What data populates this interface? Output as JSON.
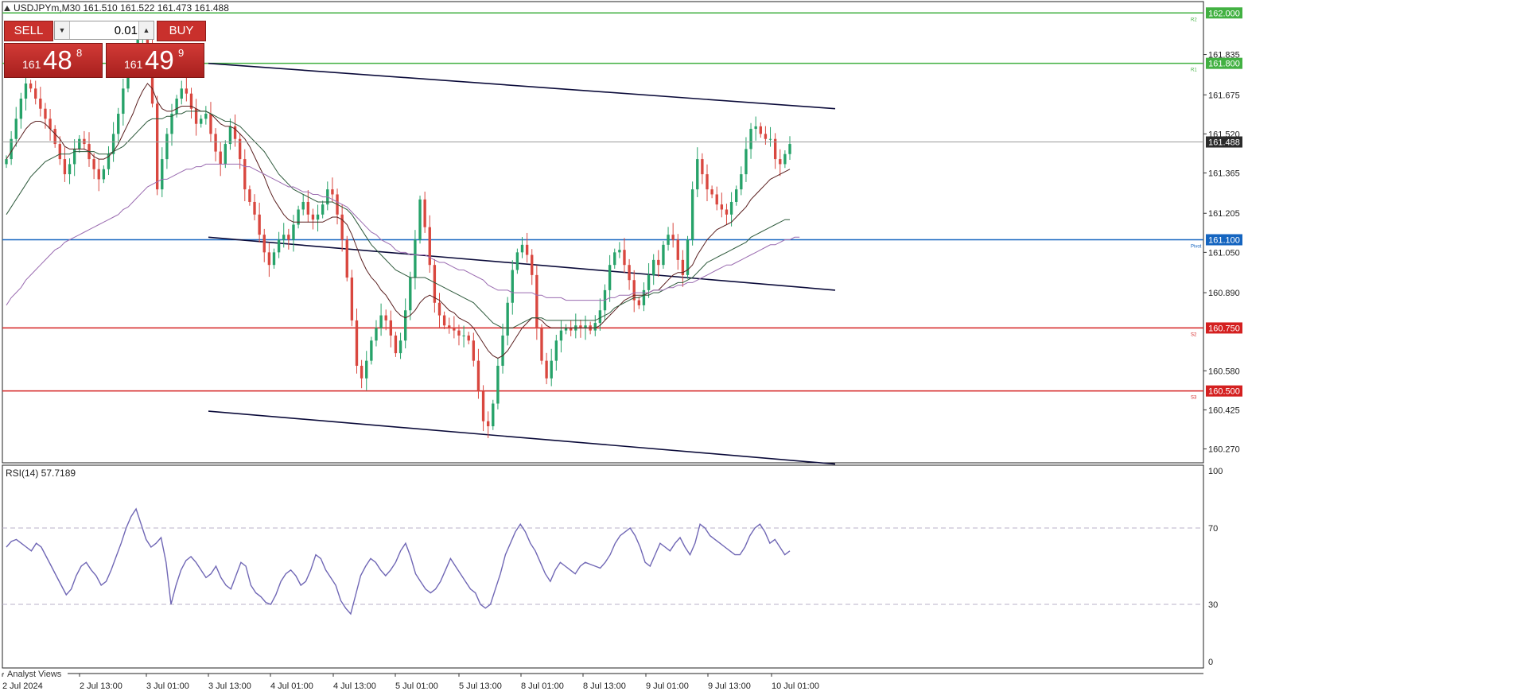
{
  "header": {
    "symbol_info": "USDJPYm,M30  161.510 161.522 161.473 161.488",
    "arrow_icon": "triangle-up-icon"
  },
  "trade_panel": {
    "sell_label": "SELL",
    "buy_label": "BUY",
    "lot_value": "0.01",
    "sell_price": {
      "prefix": "161",
      "big": "48",
      "sup": "8"
    },
    "buy_price": {
      "prefix": "161",
      "big": "49",
      "sup": "9"
    }
  },
  "indicator": {
    "label": "RSI(14) 57.7189"
  },
  "bottom_tab": "Analyst Views",
  "colors": {
    "bull": "#26a269",
    "bear": "#d9473f",
    "green_line": "#42b142",
    "blue_line": "#1565c0",
    "red_line": "#d42020",
    "rsi_line": "#7067b5",
    "ma_fast": "#5a1f1f",
    "ma_mid": "#2e5a3c",
    "ma_slow": "#9a6bb0"
  },
  "chart_data": {
    "type": "candlestick",
    "symbol": "USDJPYm",
    "timeframe": "M30",
    "ohlc_header": {
      "open": 161.51,
      "high": 161.522,
      "low": 161.473,
      "close": 161.488
    },
    "current_price": 161.488,
    "price_axis_ticks": [
      161.835,
      161.675,
      161.52,
      161.365,
      161.205,
      161.05,
      160.89,
      160.58,
      160.425,
      160.27
    ],
    "ylim": [
      160.215,
      162.045
    ],
    "x_tick_labels": [
      "2 Jul 2024",
      "2 Jul 13:00",
      "3 Jul 01:00",
      "3 Jul 13:00",
      "4 Jul 01:00",
      "4 Jul 13:00",
      "5 Jul 01:00",
      "5 Jul 13:00",
      "8 Jul 01:00",
      "8 Jul 13:00",
      "9 Jul 01:00",
      "9 Jul 13:00",
      "10 Jul 01:00"
    ],
    "horizontal_levels": [
      {
        "price": 162.0,
        "label": "162.000",
        "tag": "R2",
        "color": "#42b142"
      },
      {
        "price": 161.8,
        "label": "161.800",
        "tag": "R1",
        "color": "#42b142"
      },
      {
        "price": 161.1,
        "label": "161.100",
        "tag": "Pivot",
        "color": "#1565c0"
      },
      {
        "price": 160.75,
        "label": "160.750",
        "tag": "S2",
        "color": "#d42020"
      },
      {
        "price": 160.5,
        "label": "160.500",
        "tag": "S3",
        "color": "#d42020"
      }
    ],
    "trend_channel": [
      {
        "from": [
          "3 Jul 13:00",
          161.8
        ],
        "to": [
          "10 Jul 13:00",
          161.62
        ]
      },
      {
        "from": [
          "3 Jul 13:00",
          161.11
        ],
        "to": [
          "10 Jul 13:00",
          160.9
        ]
      },
      {
        "from": [
          "3 Jul 13:00",
          160.42
        ],
        "to": [
          "10 Jul 13:00",
          160.21
        ]
      }
    ],
    "close_series": [
      161.42,
      161.5,
      161.58,
      161.66,
      161.72,
      161.7,
      161.66,
      161.62,
      161.58,
      161.54,
      161.48,
      161.42,
      161.36,
      161.4,
      161.46,
      161.5,
      161.48,
      161.42,
      161.38,
      161.34,
      161.38,
      161.44,
      161.52,
      161.6,
      161.7,
      161.78,
      161.84,
      161.9,
      161.92,
      161.88,
      161.64,
      161.3,
      161.42,
      161.52,
      161.6,
      161.66,
      161.7,
      161.68,
      161.62,
      161.56,
      161.58,
      161.6,
      161.52,
      161.45,
      161.4,
      161.48,
      161.55,
      161.5,
      161.42,
      161.3,
      161.25,
      161.2,
      161.12,
      161.05,
      161.0,
      161.05,
      161.1,
      161.12,
      161.1,
      161.16,
      161.22,
      161.25,
      161.2,
      161.18,
      161.2,
      161.24,
      161.3,
      161.28,
      161.2,
      161.1,
      160.95,
      160.78,
      160.6,
      160.55,
      160.62,
      160.7,
      160.75,
      160.8,
      160.78,
      160.72,
      160.65,
      160.7,
      160.82,
      160.95,
      161.1,
      161.26,
      161.15,
      161.0,
      160.85,
      160.8,
      160.76,
      160.75,
      160.74,
      160.72,
      160.72,
      160.7,
      160.62,
      160.5,
      160.38,
      160.36,
      160.45,
      160.6,
      160.72,
      160.85,
      160.98,
      161.05,
      161.08,
      161.04,
      160.96,
      160.75,
      160.62,
      160.55,
      160.62,
      160.7,
      160.74,
      160.75,
      160.74,
      160.76,
      160.75,
      160.76,
      160.74,
      160.77,
      160.82,
      160.9,
      161.0,
      161.05,
      161.06,
      161.0,
      160.94,
      160.86,
      160.84,
      160.9,
      160.96,
      161.02,
      161.0,
      161.08,
      161.12,
      161.1,
      161.02,
      160.96,
      161.1,
      161.3,
      161.42,
      161.36,
      161.3,
      161.28,
      161.24,
      161.22,
      161.2,
      161.25,
      161.3,
      161.36,
      161.46,
      161.54,
      161.55,
      161.52,
      161.5,
      161.5,
      161.42,
      161.4,
      161.44,
      161.48
    ],
    "ma_fast": [
      161.42,
      161.45,
      161.48,
      161.51,
      161.54,
      161.56,
      161.57,
      161.57,
      161.56,
      161.54,
      161.52,
      161.5,
      161.47,
      161.46,
      161.46,
      161.46,
      161.46,
      161.45,
      161.43,
      161.42,
      161.42,
      161.43,
      161.45,
      161.48,
      161.52,
      161.56,
      161.6,
      161.65,
      161.69,
      161.72,
      161.7,
      161.65,
      161.62,
      161.61,
      161.61,
      161.62,
      161.63,
      161.63,
      161.63,
      161.62,
      161.61,
      161.61,
      161.6,
      161.58,
      161.56,
      161.55,
      161.55,
      161.54,
      161.52,
      161.5,
      161.47,
      161.43,
      161.39,
      161.35,
      161.3,
      161.26,
      161.23,
      161.2,
      161.18,
      161.17,
      161.17,
      161.17,
      161.17,
      161.17,
      161.17,
      161.17,
      161.18,
      161.19,
      161.19,
      161.18,
      161.16,
      161.12,
      161.07,
      161.02,
      160.98,
      160.95,
      160.93,
      160.9,
      160.88,
      160.85,
      160.82,
      160.8,
      160.79,
      160.8,
      160.82,
      160.85,
      160.87,
      160.88,
      160.87,
      160.86,
      160.84,
      160.82,
      160.81,
      160.79,
      160.78,
      160.77,
      160.75,
      160.72,
      160.69,
      160.66,
      160.64,
      160.63,
      160.64,
      160.66,
      160.69,
      160.72,
      160.75,
      160.77,
      160.79,
      160.79,
      160.78,
      160.76,
      160.75,
      160.75,
      160.75,
      160.75,
      160.75,
      160.75,
      160.75,
      160.75,
      160.75,
      160.75,
      160.76,
      160.78,
      160.8,
      160.82,
      160.84,
      160.86,
      160.87,
      160.88,
      160.88,
      160.88,
      160.89,
      160.9,
      160.9,
      160.92,
      160.94,
      160.96,
      160.97,
      160.97,
      160.98,
      161.0,
      161.04,
      161.07,
      161.1,
      161.12,
      161.14,
      161.15,
      161.16,
      161.17,
      161.19,
      161.21,
      161.23,
      161.26,
      161.28,
      161.3,
      161.32,
      161.34,
      161.35,
      161.36,
      161.37,
      161.38
    ],
    "ma_mid": [
      161.2,
      161.23,
      161.26,
      161.29,
      161.32,
      161.35,
      161.37,
      161.39,
      161.41,
      161.42,
      161.43,
      161.44,
      161.44,
      161.44,
      161.45,
      161.45,
      161.45,
      161.45,
      161.45,
      161.44,
      161.44,
      161.44,
      161.45,
      161.46,
      161.47,
      161.49,
      161.51,
      161.53,
      161.55,
      161.57,
      161.58,
      161.58,
      161.58,
      161.59,
      161.59,
      161.6,
      161.6,
      161.61,
      161.61,
      161.61,
      161.61,
      161.61,
      161.6,
      161.59,
      161.58,
      161.57,
      161.57,
      161.56,
      161.55,
      161.53,
      161.51,
      161.49,
      161.47,
      161.45,
      161.42,
      161.39,
      161.36,
      161.34,
      161.32,
      161.3,
      161.29,
      161.28,
      161.27,
      161.26,
      161.25,
      161.25,
      161.25,
      161.25,
      161.24,
      161.23,
      161.22,
      161.2,
      161.17,
      161.14,
      161.11,
      161.08,
      161.06,
      161.04,
      161.02,
      161.0,
      160.98,
      160.97,
      160.96,
      160.95,
      160.95,
      160.95,
      160.95,
      160.94,
      160.93,
      160.92,
      160.91,
      160.9,
      160.89,
      160.88,
      160.87,
      160.86,
      160.85,
      160.83,
      160.81,
      160.79,
      160.77,
      160.76,
      160.75,
      160.75,
      160.75,
      160.76,
      160.77,
      160.78,
      160.79,
      160.79,
      160.79,
      160.78,
      160.78,
      160.78,
      160.78,
      160.78,
      160.78,
      160.78,
      160.78,
      160.78,
      160.78,
      160.78,
      160.79,
      160.8,
      160.81,
      160.83,
      160.84,
      160.85,
      160.86,
      160.87,
      160.87,
      160.88,
      160.88,
      160.89,
      160.89,
      160.9,
      160.91,
      160.92,
      160.93,
      160.93,
      160.94,
      160.95,
      160.97,
      160.99,
      161.01,
      161.02,
      161.03,
      161.04,
      161.05,
      161.06,
      161.07,
      161.08,
      161.09,
      161.11,
      161.12,
      161.13,
      161.14,
      161.15,
      161.16,
      161.17,
      161.18,
      161.18
    ],
    "ma_slow": [
      160.84,
      160.87,
      160.89,
      160.91,
      160.94,
      160.96,
      160.98,
      161.0,
      161.02,
      161.04,
      161.06,
      161.07,
      161.09,
      161.1,
      161.11,
      161.12,
      161.13,
      161.14,
      161.15,
      161.16,
      161.17,
      161.18,
      161.19,
      161.2,
      161.22,
      161.23,
      161.25,
      161.27,
      161.29,
      161.31,
      161.32,
      161.33,
      161.34,
      161.34,
      161.35,
      161.36,
      161.37,
      161.38,
      161.38,
      161.39,
      161.39,
      161.4,
      161.4,
      161.4,
      161.4,
      161.4,
      161.4,
      161.4,
      161.4,
      161.39,
      161.39,
      161.38,
      161.37,
      161.36,
      161.35,
      161.34,
      161.33,
      161.32,
      161.31,
      161.31,
      161.3,
      161.29,
      161.29,
      161.28,
      161.28,
      161.27,
      161.27,
      161.26,
      161.25,
      161.24,
      161.23,
      161.21,
      161.19,
      161.17,
      161.15,
      161.13,
      161.12,
      161.1,
      161.09,
      161.08,
      161.06,
      161.05,
      161.05,
      161.04,
      161.04,
      161.04,
      161.04,
      161.03,
      161.02,
      161.01,
      161.01,
      161.0,
      160.99,
      160.98,
      160.98,
      160.97,
      160.96,
      160.95,
      160.94,
      160.92,
      160.91,
      160.9,
      160.9,
      160.9,
      160.89,
      160.89,
      160.89,
      160.89,
      160.89,
      160.88,
      160.88,
      160.87,
      160.87,
      160.87,
      160.87,
      160.86,
      160.86,
      160.86,
      160.86,
      160.86,
      160.86,
      160.86,
      160.86,
      160.86,
      160.87,
      160.87,
      160.88,
      160.88,
      160.88,
      160.89,
      160.89,
      160.89,
      160.89,
      160.9,
      160.9,
      160.9,
      160.91,
      160.91,
      160.92,
      160.92,
      160.93,
      160.93,
      160.94,
      160.95,
      160.96,
      160.97,
      160.98,
      160.99,
      161.0,
      161.0,
      161.01,
      161.02,
      161.03,
      161.04,
      161.05,
      161.06,
      161.07,
      161.08,
      161.08,
      161.09,
      161.1,
      161.1,
      161.11,
      161.11
    ]
  },
  "rsi_data": {
    "type": "line",
    "name": "RSI(14)",
    "current": 57.7189,
    "ylim": [
      0,
      100
    ],
    "y_ticks": [
      100,
      70,
      30,
      0
    ],
    "levels": [
      70,
      30
    ],
    "values": [
      60,
      63,
      64,
      62,
      60,
      58,
      62,
      60,
      55,
      50,
      45,
      40,
      35,
      38,
      45,
      50,
      52,
      48,
      45,
      40,
      42,
      48,
      55,
      62,
      70,
      76,
      80,
      72,
      64,
      60,
      62,
      65,
      52,
      30,
      40,
      48,
      53,
      55,
      52,
      48,
      44,
      46,
      50,
      44,
      40,
      38,
      45,
      52,
      50,
      40,
      36,
      34,
      31,
      30,
      35,
      42,
      46,
      48,
      45,
      40,
      42,
      48,
      56,
      54,
      48,
      44,
      40,
      32,
      28,
      25,
      35,
      45,
      50,
      54,
      52,
      48,
      45,
      48,
      52,
      58,
      62,
      55,
      46,
      42,
      38,
      36,
      38,
      42,
      48,
      54,
      50,
      46,
      42,
      38,
      36,
      30,
      28,
      30,
      38,
      46,
      56,
      62,
      68,
      72,
      68,
      62,
      58,
      52,
      46,
      42,
      48,
      52,
      50,
      48,
      46,
      50,
      52,
      51,
      50,
      49,
      52,
      56,
      62,
      66,
      68,
      70,
      66,
      60,
      52,
      50,
      56,
      62,
      60,
      58,
      62,
      65,
      60,
      56,
      62,
      72,
      70,
      66,
      64,
      62,
      60,
      58,
      56,
      56,
      60,
      66,
      70,
      72,
      68,
      62,
      64,
      60,
      56,
      58
    ]
  }
}
